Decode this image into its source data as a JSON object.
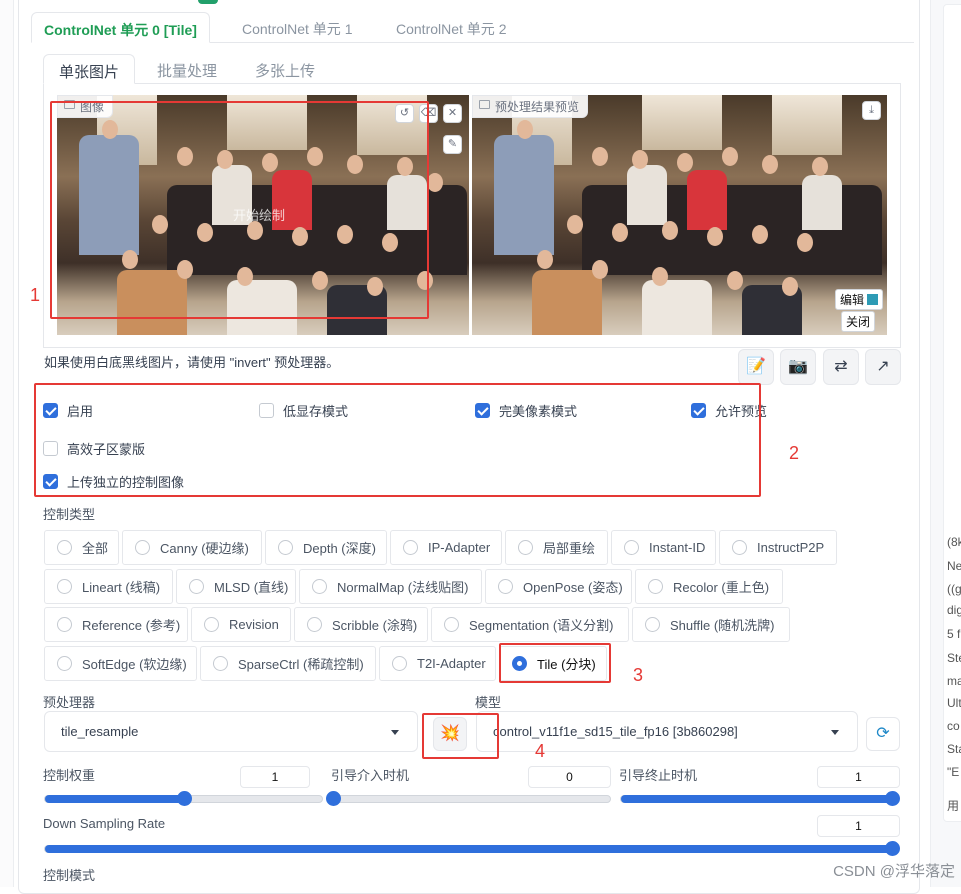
{
  "unit_tabs": [
    "ControlNet 单元 0 [Tile]",
    "ControlNet 单元 1",
    "ControlNet 单元 2"
  ],
  "sub_tabs": [
    "单张图片",
    "批量处理",
    "多张上传"
  ],
  "image_panel": {
    "input_label": "图像",
    "output_label": "预处理结果预览",
    "start_draw": "开始绘制",
    "edit_label": "编辑",
    "close_label": "关闭"
  },
  "hint": "如果使用白底黑线图片，请使用 \"invert\" 预处理器。",
  "checkboxes": [
    {
      "label": "启用",
      "checked": true
    },
    {
      "label": "低显存模式",
      "checked": false
    },
    {
      "label": "完美像素模式",
      "checked": true
    },
    {
      "label": "允许预览",
      "checked": true
    },
    {
      "label": "高效子区蒙版",
      "checked": false
    },
    {
      "label": "上传独立的控制图像",
      "checked": true
    }
  ],
  "control_type": {
    "label": "控制类型",
    "options": [
      "全部",
      "Canny (硬边缘)",
      "Depth (深度)",
      "IP-Adapter",
      "局部重绘",
      "Instant-ID",
      "InstructP2P",
      "Lineart (线稿)",
      "MLSD (直线)",
      "NormalMap (法线贴图)",
      "OpenPose (姿态)",
      "Recolor (重上色)",
      "Reference (参考)",
      "Revision",
      "Scribble (涂鸦)",
      "Segmentation (语义分割)",
      "Shuffle (随机洗牌)",
      "SoftEdge (软边缘)",
      "SparseCtrl (稀疏控制)",
      "T2I-Adapter",
      "Tile (分块)"
    ],
    "selected": "Tile (分块)"
  },
  "preprocessor": {
    "label": "预处理器",
    "value": "tile_resample"
  },
  "model": {
    "label": "模型",
    "value": "control_v11f1e_sd15_tile_fp16 [3b860298]"
  },
  "sliders": {
    "control_weight": {
      "label": "控制权重",
      "value": "1",
      "fraction": 0.5
    },
    "start_step": {
      "label": "引导介入时机",
      "value": "0",
      "fraction": 0.0
    },
    "end_step": {
      "label": "引导终止时机",
      "value": "1",
      "fraction": 1.0
    },
    "down_sampling": {
      "label": "Down Sampling Rate",
      "value": "1",
      "fraction": 1.0
    }
  },
  "control_mode_label": "控制模式",
  "annotations": [
    "1",
    "2",
    "3",
    "4"
  ],
  "right_panel_lines": [
    "(8k",
    "Ne",
    "((g",
    "dig",
    "5 f",
    "Ste",
    "ma",
    "Ult",
    "co",
    "Sta",
    "\"E",
    "用"
  ],
  "watermark": "CSDN @浮华落定",
  "colors": {
    "accent": "#2f6fdc",
    "tab_active": "#1f9d55",
    "annotation": "#e53935"
  }
}
